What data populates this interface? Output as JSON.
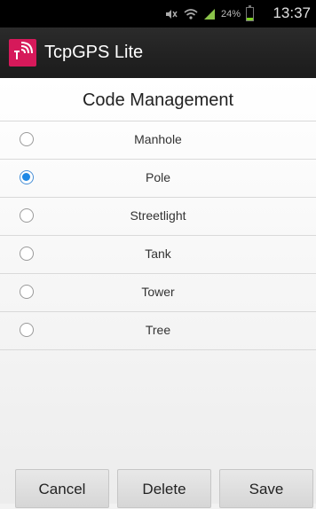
{
  "status_bar": {
    "battery_percent": "24%",
    "battery_level": 0.24,
    "time": "13:37",
    "icons": [
      "mute-icon",
      "wifi-icon",
      "signal-icon",
      "battery-icon"
    ]
  },
  "app_bar": {
    "app_name": "TcpGPS Lite",
    "logo_color": "#d6195a"
  },
  "screen": {
    "title": "Code Management",
    "items": [
      {
        "label": "Manhole",
        "selected": false
      },
      {
        "label": "Pole",
        "selected": true
      },
      {
        "label": "Streetlight",
        "selected": false
      },
      {
        "label": "Tank",
        "selected": false
      },
      {
        "label": "Tower",
        "selected": false
      },
      {
        "label": "Tree",
        "selected": false
      }
    ]
  },
  "buttons": {
    "cancel": "Cancel",
    "delete": "Delete",
    "save": "Save"
  },
  "colors": {
    "accent": "#1e88e5"
  }
}
